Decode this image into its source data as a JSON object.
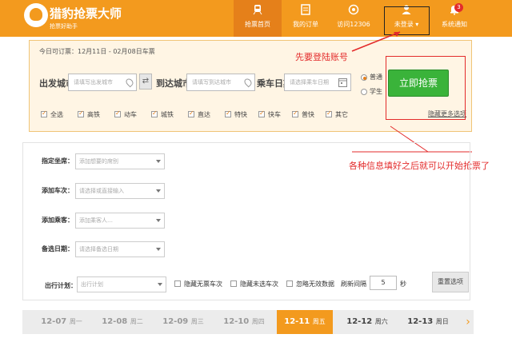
{
  "header": {
    "brand": "猎豹抢票大师",
    "brand_sub": "抢票好助手",
    "nav": [
      {
        "label": "抢票首页",
        "icon": "train-icon"
      },
      {
        "label": "我的订单",
        "icon": "order-icon"
      },
      {
        "label": "访问12306",
        "icon": "globe-icon"
      },
      {
        "label": "未登录 ▾",
        "icon": "user-icon"
      },
      {
        "label": "系统通知",
        "icon": "bell-icon"
      }
    ],
    "notice_count": "3"
  },
  "search": {
    "bookable_range": "今日可订票：12月11日 - 02月08日车票",
    "from_label": "出发城市",
    "from_placeholder": "请填写出发城市",
    "to_label": "到达城市",
    "to_placeholder": "请填写到达城市",
    "date_label": "乘车日期",
    "date_placeholder": "请选择乘车日期",
    "ticket_types": [
      "普通",
      "学生"
    ],
    "grab_button": "立即抢票",
    "more_options": "隐藏更多选项",
    "train_types": [
      "全选",
      "高铁",
      "动车",
      "城铁",
      "直达",
      "特快",
      "快车",
      "普快",
      "其它"
    ]
  },
  "annotations": {
    "login_first": "先要登陆账号",
    "fill_info": "各种信息填好之后就可以开始抢票了"
  },
  "filters": {
    "seat_label": "指定坐席：",
    "seat_placeholder": "添加想要的席别",
    "train_label": "添加车次：",
    "train_placeholder": "请选择或直接输入",
    "passenger_label": "添加乘客：",
    "passenger_placeholder": "添加乘客人…",
    "backup_label": "备选日期：",
    "backup_placeholder": "请选择备选日期"
  },
  "plan": {
    "label": "出行计划：",
    "placeholder": "出行计划",
    "hide_no_ticket": "隐藏无票车次",
    "hide_unselected": "隐藏未选车次",
    "ignore_invalid": "忽略无效数据",
    "refresh_label": "刷新间隔",
    "refresh_value": "5",
    "refresh_unit": "秒",
    "reset_button": "重置选项"
  },
  "date_strip": [
    {
      "date": "12-07",
      "day": "周一"
    },
    {
      "date": "12-08",
      "day": "周二"
    },
    {
      "date": "12-09",
      "day": "周三"
    },
    {
      "date": "12-10",
      "day": "周四"
    },
    {
      "date": "12-11",
      "day": "周五"
    },
    {
      "date": "12-12",
      "day": "周六"
    },
    {
      "date": "12-13",
      "day": "周日"
    }
  ],
  "colors": {
    "brand_orange": "#f39a1e",
    "grab_green": "#3ab33a",
    "annotation_red": "#e32b2b"
  }
}
